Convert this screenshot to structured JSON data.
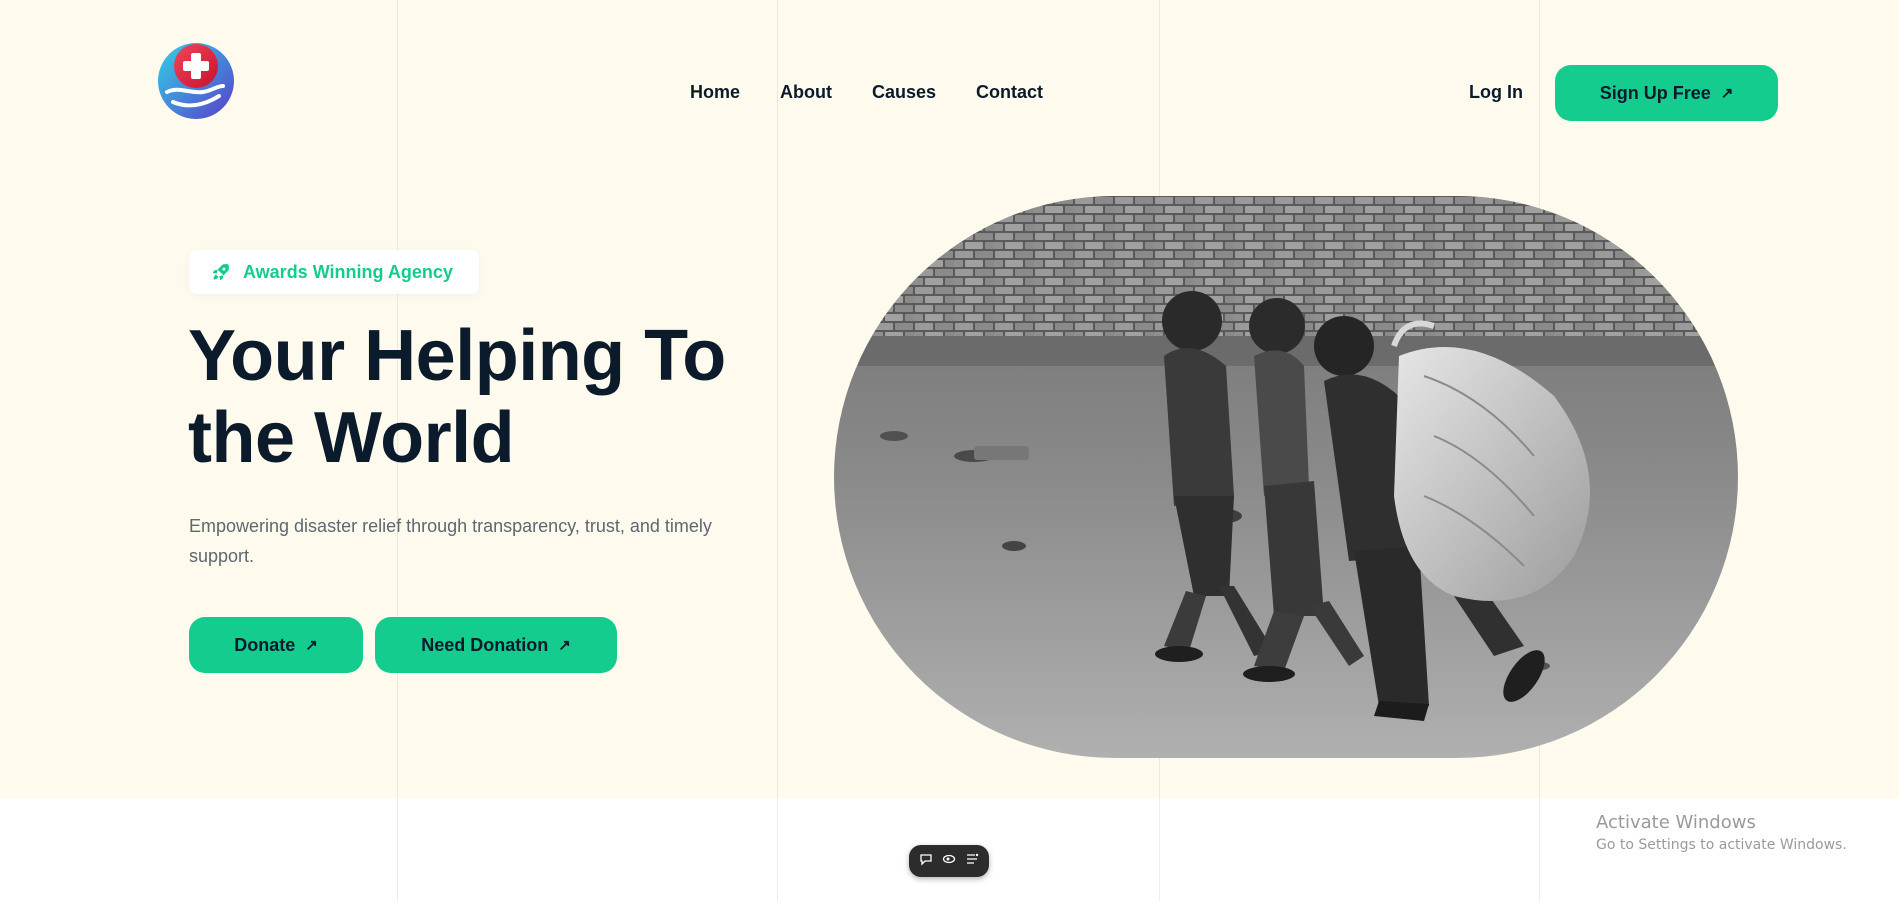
{
  "nav": {
    "items": [
      {
        "label": "Home"
      },
      {
        "label": "About"
      },
      {
        "label": "Causes"
      },
      {
        "label": "Contact"
      }
    ],
    "login_label": "Log In",
    "signup_label": "Sign Up Free"
  },
  "hero": {
    "badge": "Awards Winning Agency",
    "headline_line1": "Your Helping To",
    "headline_line2": "the World",
    "subtext": "Empowering disaster relief through transparency, trust, and timely support.",
    "donate_label": "Donate",
    "need_label": "Need Donation"
  },
  "windows_notice": {
    "title": "Activate Windows",
    "subtitle": "Go to Settings to activate Windows."
  },
  "icons": {
    "logo": "medical-cross-hand-icon",
    "badge": "rocket-icon",
    "arrow": "arrow-up-right-icon",
    "toolbar": [
      "comment-icon",
      "eye-icon",
      "list-icon"
    ]
  },
  "colors": {
    "accent": "#14cc8e",
    "hero_bg": "#fefbee",
    "text": "#0b1b2b",
    "muted": "#5f6770"
  }
}
